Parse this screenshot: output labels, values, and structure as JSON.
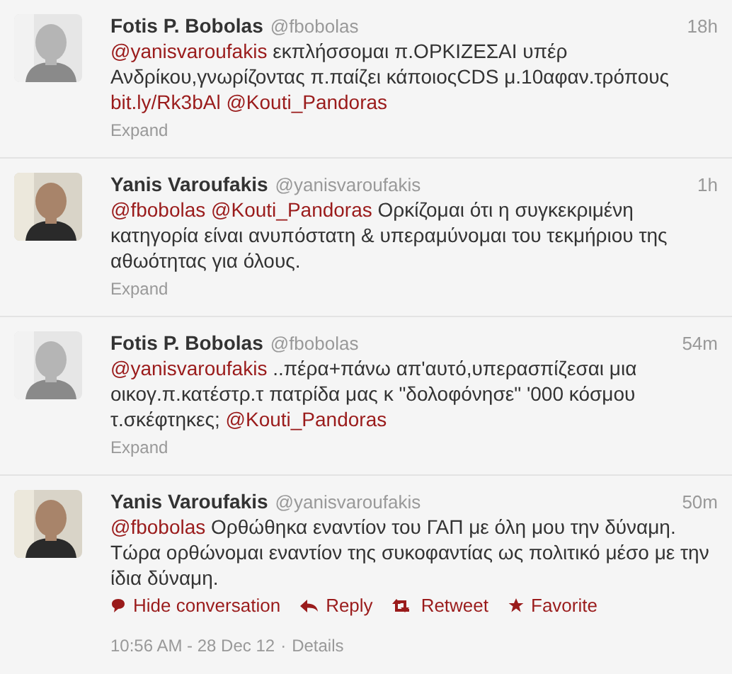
{
  "tweets": [
    {
      "name": "Fotis P. Bobolas",
      "handle": "@fbobolas",
      "time": "18h",
      "text": [
        {
          "kind": "mention",
          "text": "@yanisvaroufakis"
        },
        {
          "kind": "text",
          "text": " εκπλήσσομαι π.ΟΡΚΙΖΕΣΑΙ υπέρ Ανδρίκου,γνωρίζοντας π.παίζει κάποιοςCDS μ.10αφαν.τρόπους "
        },
        {
          "kind": "link",
          "text": "bit.ly/Rk3bAl @Kouti_Pandoras"
        }
      ],
      "expand": "Expand"
    },
    {
      "name": "Yanis Varoufakis",
      "handle": "@yanisvaroufakis",
      "time": "1h",
      "text": [
        {
          "kind": "mention",
          "text": "@fbobolas @Kouti_Pandoras"
        },
        {
          "kind": "text",
          "text": " Ορκίζομαι ότι η συγκεκριμένη κατηγορία είναι ανυπόστατη & υπεραμύνομαι του τεκμήριου της αθωότητας για όλους."
        }
      ],
      "expand": "Expand"
    },
    {
      "name": "Fotis P. Bobolas",
      "handle": "@fbobolas",
      "time": "54m",
      "text": [
        {
          "kind": "mention",
          "text": "@yanisvaroufakis"
        },
        {
          "kind": "text",
          "text": " ..πέρα+πάνω απ'αυτό,υπερασπίζεσαι μια οικογ.π.κατέστρ.τ πατρίδα μας κ \"δολοφόνησε\" '000 κόσμου τ.σκέφτηκες; "
        },
        {
          "kind": "mention",
          "text": "@Kouti_Pandoras"
        }
      ],
      "expand": "Expand"
    },
    {
      "name": "Yanis Varoufakis",
      "handle": "@yanisvaroufakis",
      "time": "50m",
      "text": [
        {
          "kind": "mention",
          "text": "@fbobolas"
        },
        {
          "kind": "text",
          "text": " Ορθώθηκα εναντίον του ΓΑΠ με όλη μου την δύναμη. Τώρα ορθώνομαι εναντίον της συκοφαντίας ως πολιτικό μέσο με την ίδια δύναμη."
        }
      ],
      "actions": [
        {
          "kind": "conversation",
          "label": "Hide conversation"
        },
        {
          "kind": "reply",
          "label": "Reply"
        },
        {
          "kind": "retweet",
          "label": "Retweet"
        },
        {
          "kind": "favorite",
          "label": "Favorite"
        }
      ],
      "timestamp": "10:56 AM - 28 Dec 12",
      "separator": "·",
      "details": "Details"
    }
  ]
}
